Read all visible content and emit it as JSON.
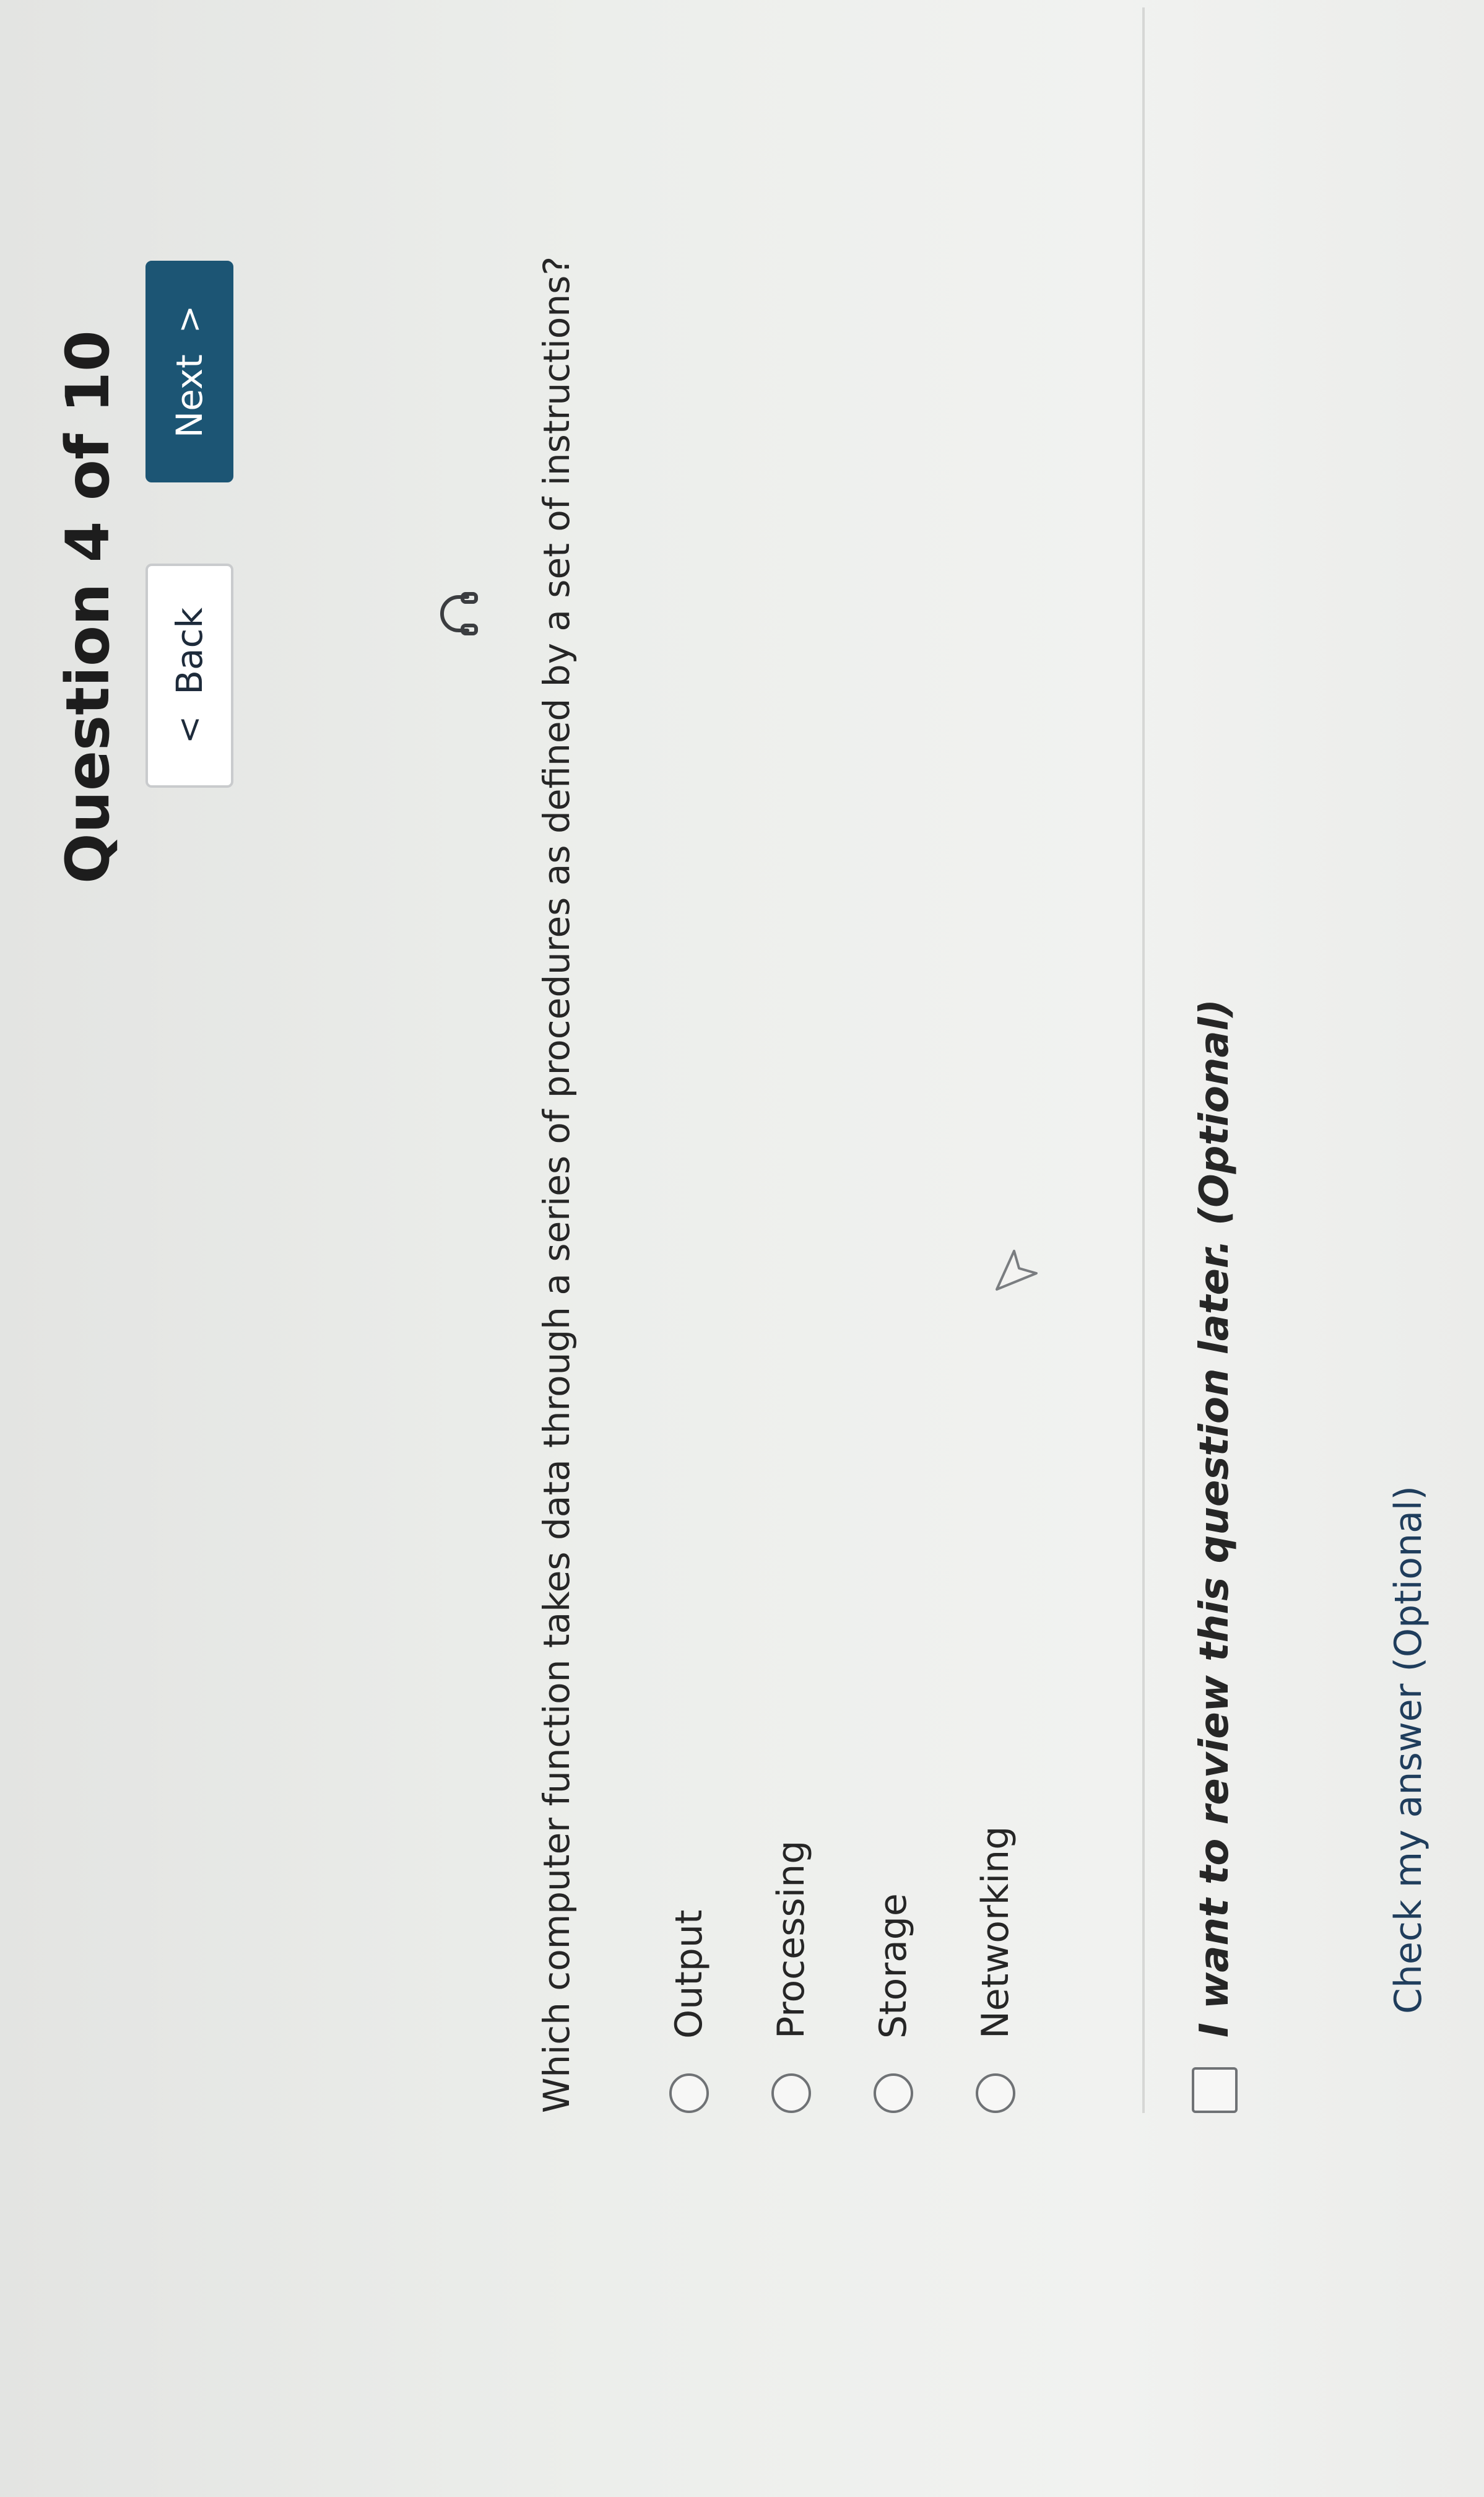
{
  "quiz": {
    "title": "Question 4 of 10",
    "nav": {
      "back_label": "Back",
      "next_label": "Next",
      "back_chevron": "<",
      "next_chevron": ">"
    },
    "audio_icon": "headphones-icon",
    "question_text": "Which computer function takes data through a series of procedures as defined by a set of instructions?",
    "options": [
      {
        "label": "Output",
        "selected": false
      },
      {
        "label": "Processing",
        "selected": false
      },
      {
        "label": "Storage",
        "selected": false
      },
      {
        "label": "Networking",
        "selected": false
      }
    ],
    "review_checkbox": {
      "label": "I want to review this question later. (Optional)",
      "checked": false
    },
    "check_answer_label": "Check my answer (Optional)"
  },
  "colors": {
    "next_button_bg": "#1c5574",
    "text": "#262626",
    "link": "#1f3d5c",
    "background": "#e9e9e7"
  }
}
